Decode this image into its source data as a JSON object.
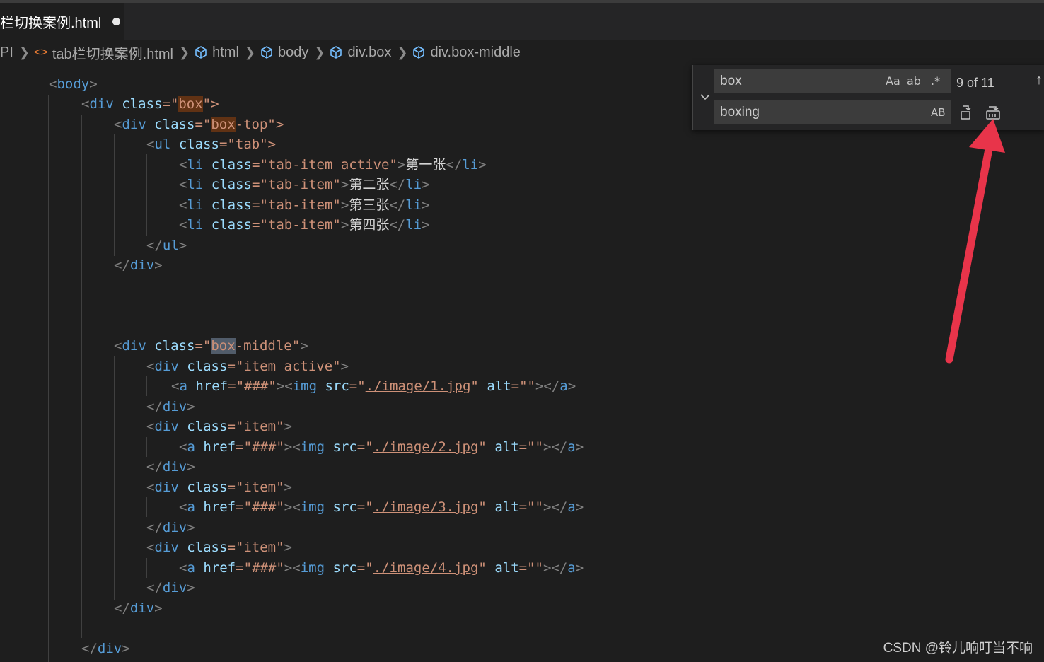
{
  "tab": {
    "title": "栏切换案例.html"
  },
  "breadcrumb": {
    "items": [
      "PI",
      "tab栏切换案例.html",
      "html",
      "body",
      "div.box",
      "div.box-middle"
    ]
  },
  "find": {
    "search_value": "box",
    "replace_value": "boxing",
    "match_case": "Aa",
    "whole_word": "ab",
    "regex": ".*",
    "preserve_case": "AB",
    "count": "9 of 11"
  },
  "code": {
    "l1": [
      "<",
      "body",
      ">"
    ],
    "l2": {
      "open": "<",
      "tag": "div",
      "attr": "class",
      "eq": "=\"",
      "hl": "box",
      "rest": "",
      "close": "\">"
    },
    "l3": {
      "open": "<",
      "tag": "div",
      "attr": "class",
      "eq": "=\"",
      "hl": "box",
      "rest": "-top",
      "close": "\">"
    },
    "l4": {
      "open": "<",
      "tag": "ul",
      "attr": "class",
      "eq": "=\"",
      "val": "tab",
      "close": "\">"
    },
    "li": [
      {
        "cls": "tab-item active",
        "text": "第一张"
      },
      {
        "cls": "tab-item",
        "text": "第二张"
      },
      {
        "cls": "tab-item",
        "text": "第三张"
      },
      {
        "cls": "tab-item",
        "text": "第四张"
      }
    ],
    "ul_close": [
      "</",
      "ul",
      ">"
    ],
    "div_close": [
      "</",
      "div",
      ">"
    ],
    "mid": {
      "hl": "box",
      "rest": "-middle"
    },
    "items": [
      {
        "cls": "item active",
        "src": "./image/1.jpg"
      },
      {
        "cls": "item",
        "src": "./image/2.jpg"
      },
      {
        "cls": "item",
        "src": "./image/3.jpg"
      },
      {
        "cls": "item",
        "src": "./image/4.jpg"
      }
    ],
    "href": "###"
  },
  "watermark": "CSDN @铃儿响叮当不响",
  "colors": {
    "tag": "#569cd6",
    "attr": "#9cdcfe",
    "string": "#ce9178",
    "highlight": "#613214",
    "arrow": "#e8344a"
  }
}
